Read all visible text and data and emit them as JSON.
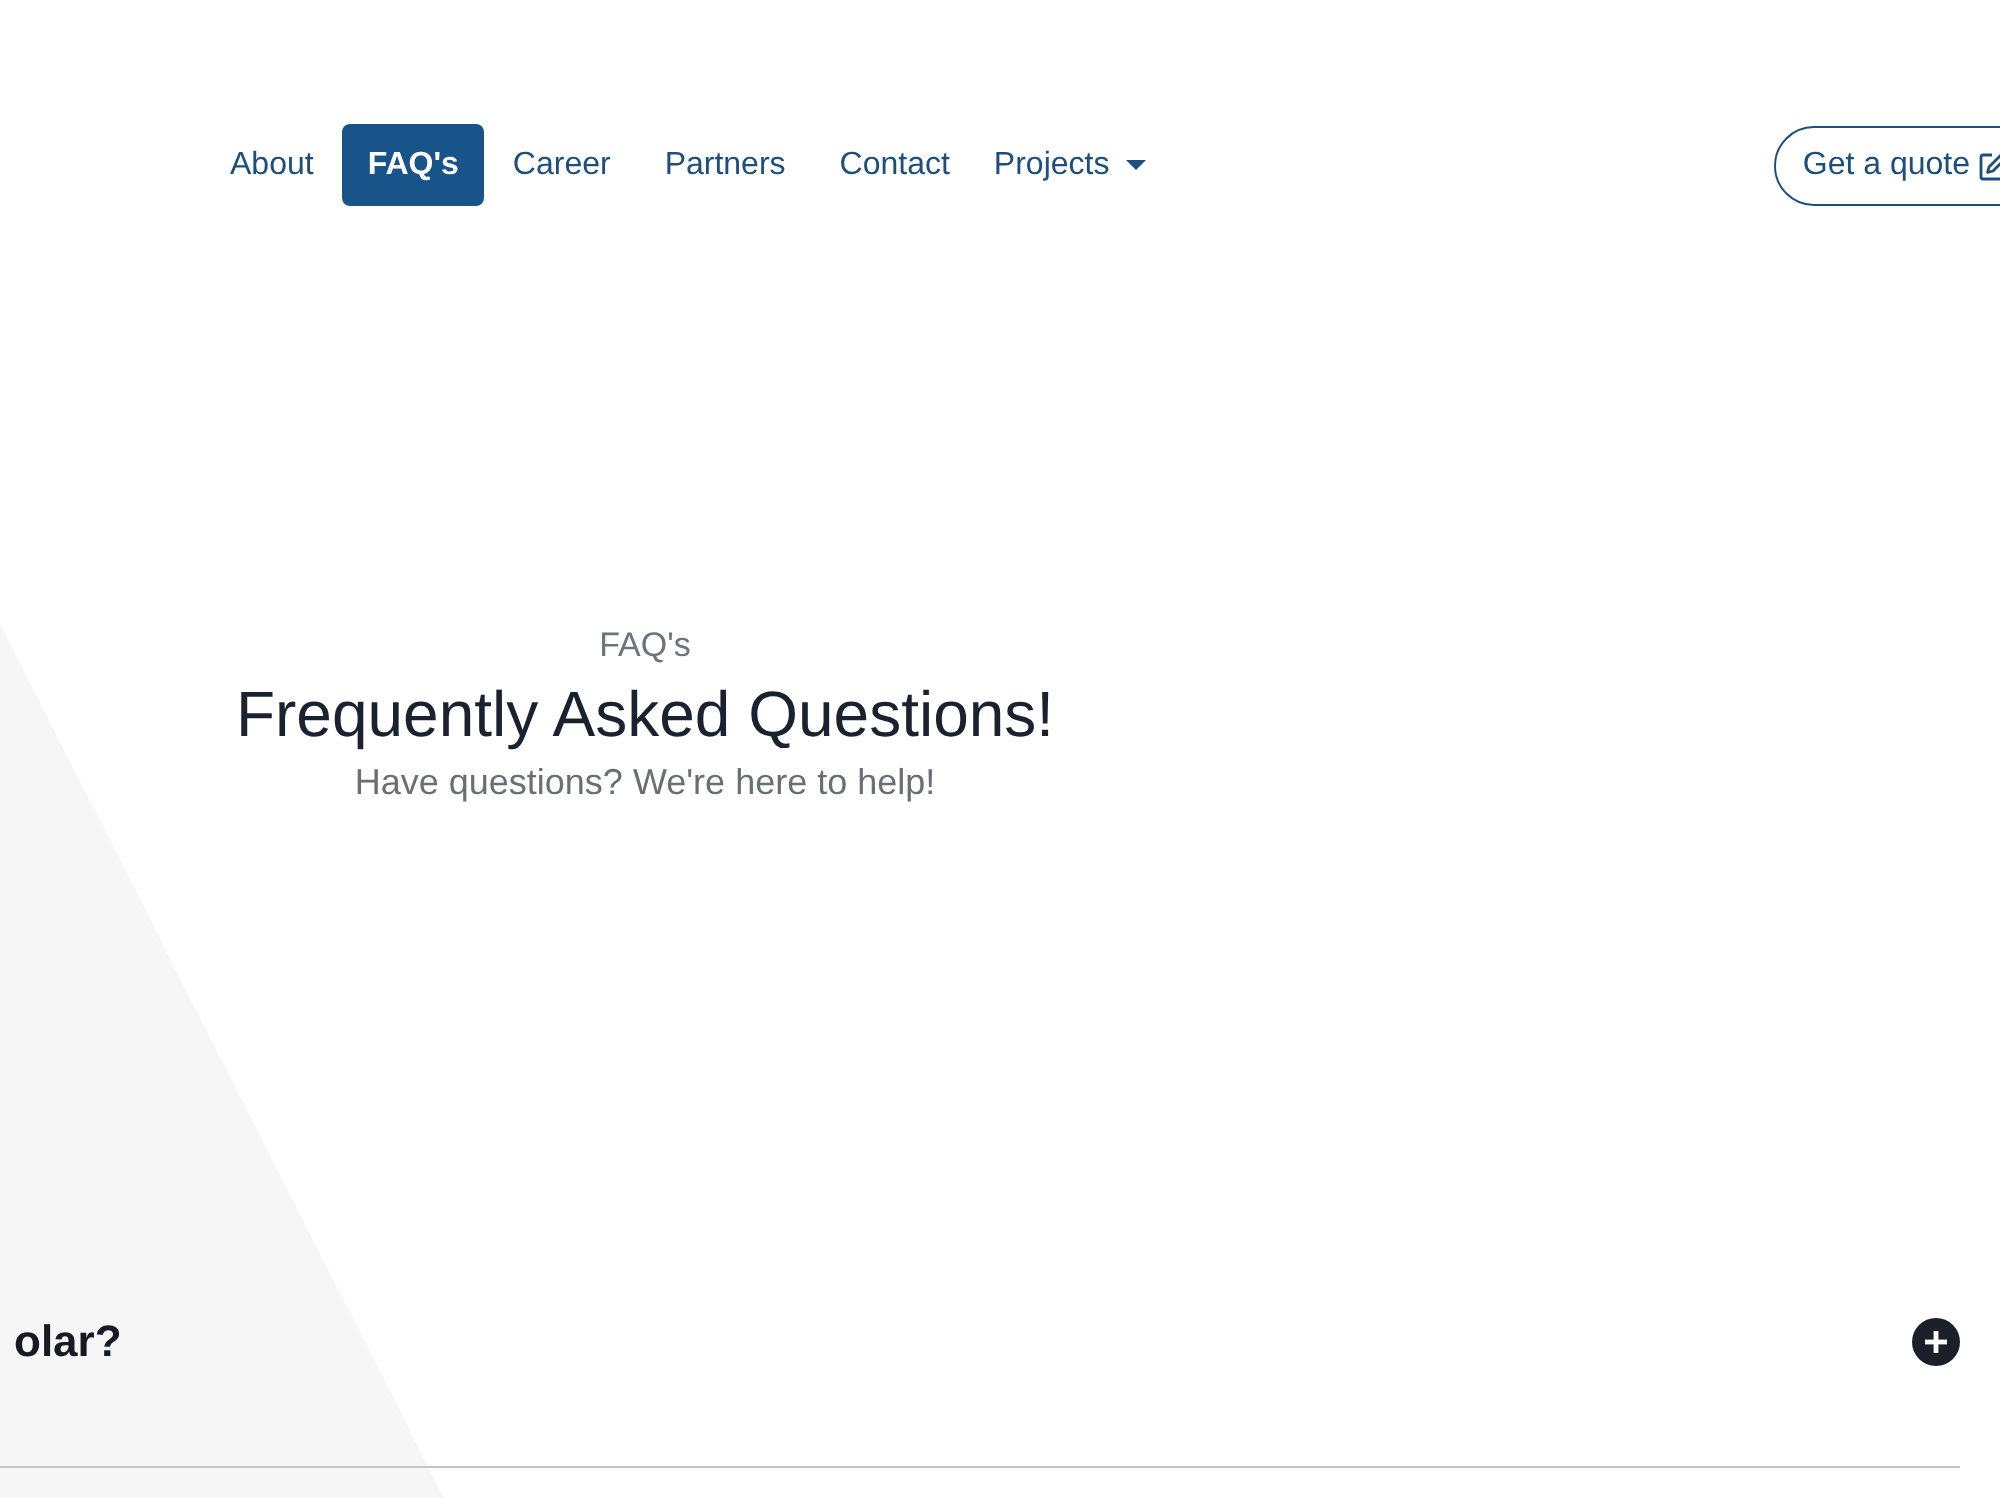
{
  "nav": {
    "links": [
      {
        "label": "About",
        "kind": "link",
        "selected": false
      },
      {
        "label": "FAQ's",
        "kind": "link",
        "selected": true
      },
      {
        "label": "Career",
        "kind": "link",
        "selected": false
      },
      {
        "label": "Partners",
        "kind": "link",
        "selected": false
      },
      {
        "label": "Contact",
        "kind": "link",
        "selected": false
      },
      {
        "label": "Projects",
        "kind": "dropdown",
        "selected": false
      }
    ],
    "quote_button": {
      "label": "Get a quote"
    }
  },
  "hero": {
    "eyebrow": "FAQ's",
    "title": "Frequently Asked Questions!",
    "subtitle": "Have questions? We're here to help!"
  },
  "faq": {
    "items": [
      {
        "question": "olar?",
        "expanded": false
      }
    ]
  }
}
